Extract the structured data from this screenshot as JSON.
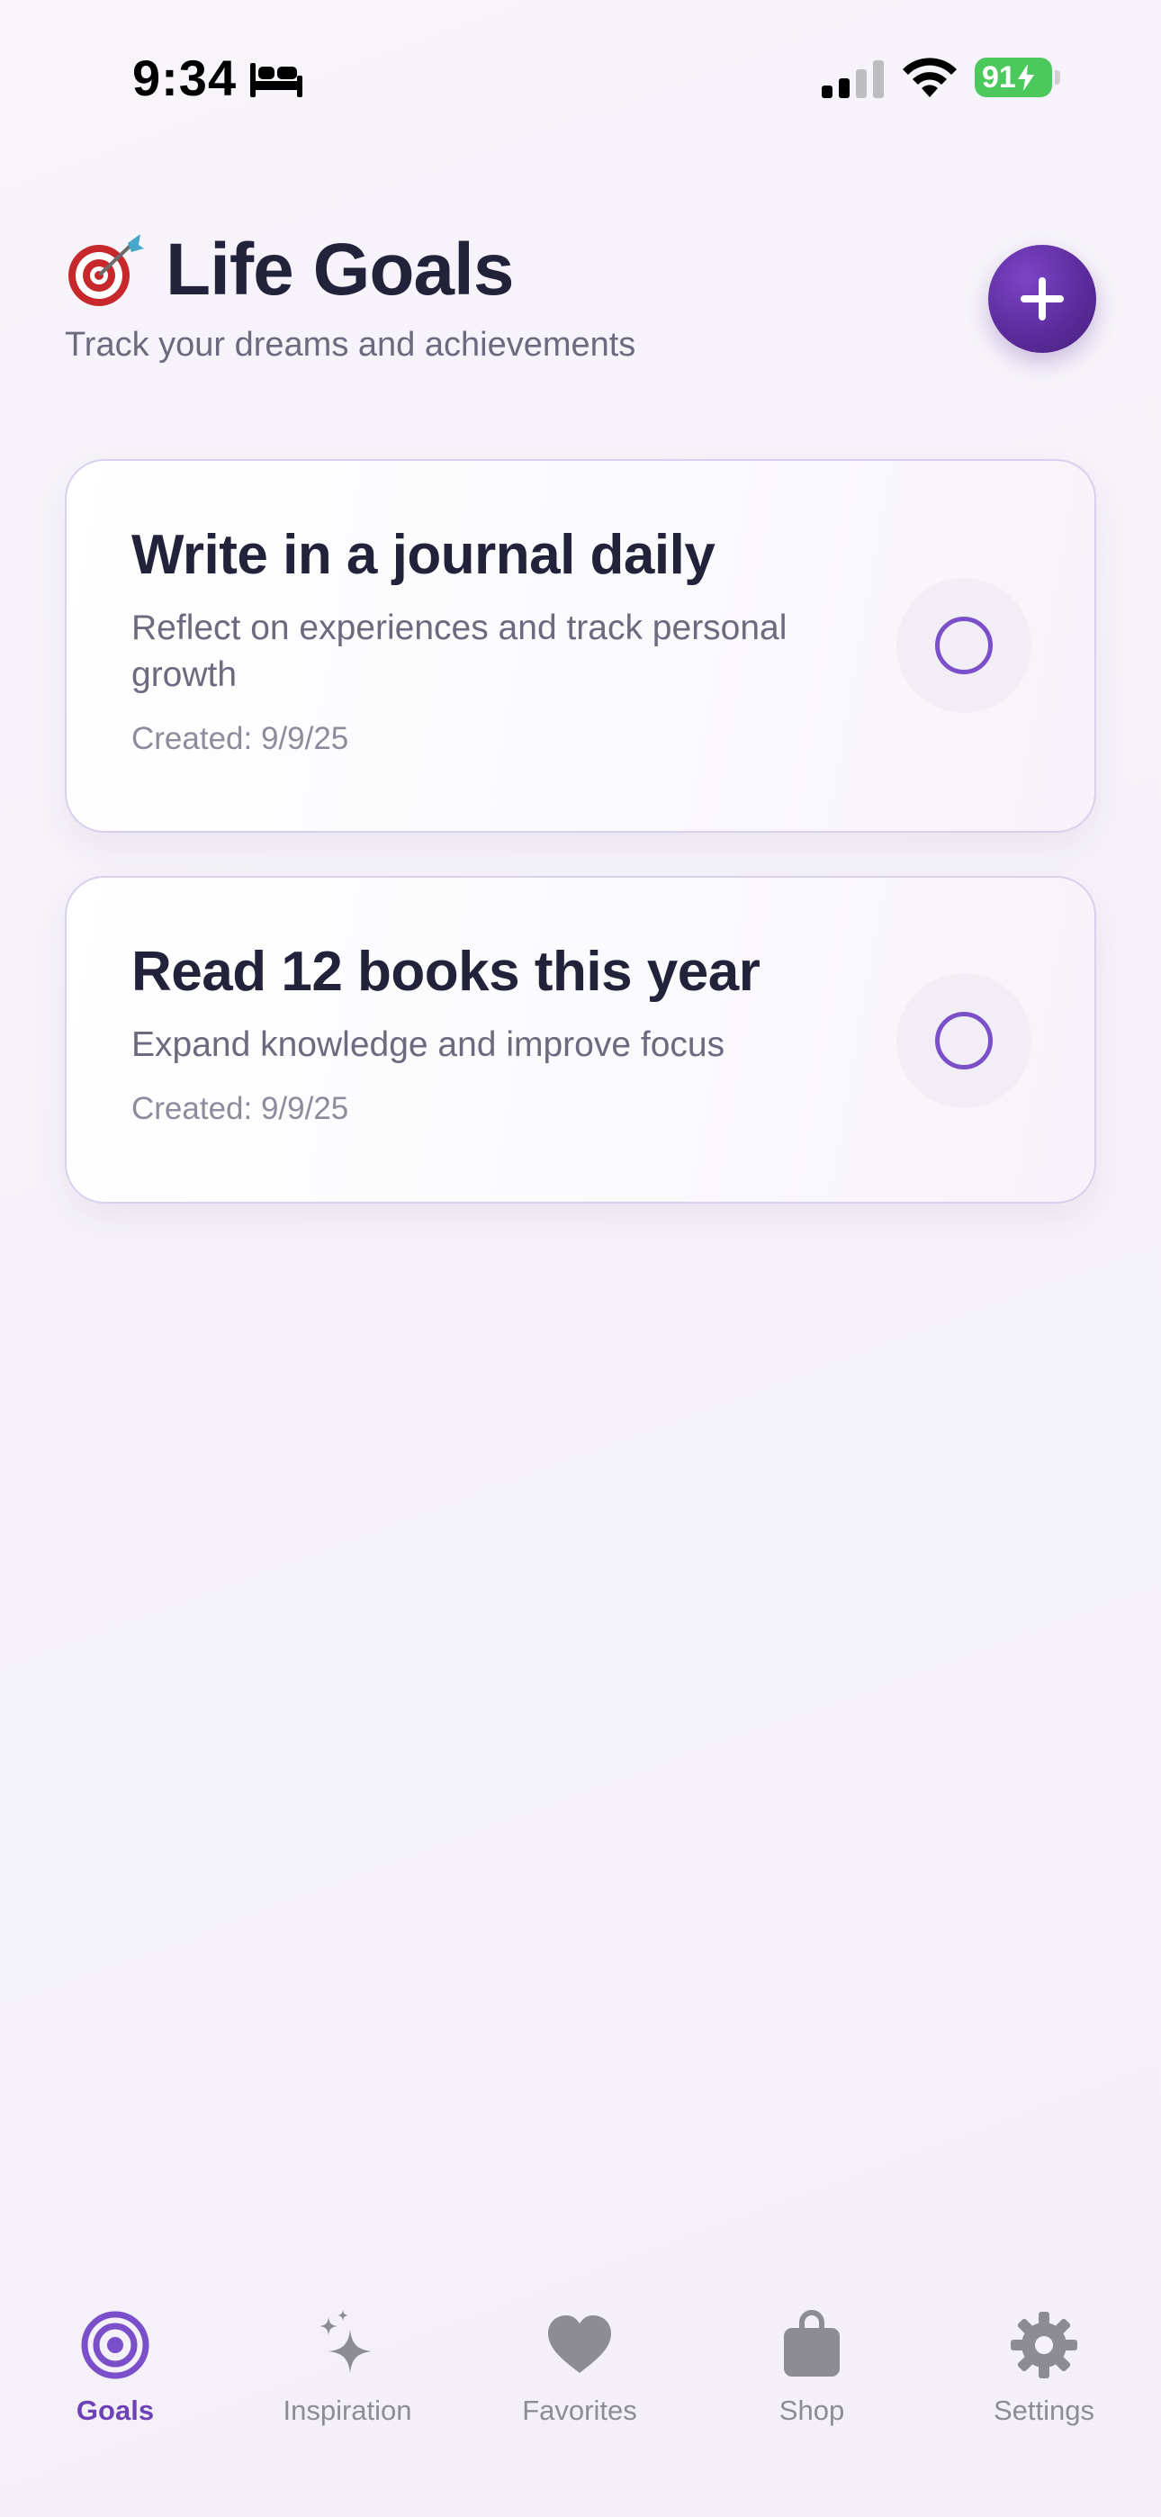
{
  "status_bar": {
    "time": "9:34",
    "battery_level": "91",
    "icons": [
      "bed-icon",
      "signal-icon",
      "wifi-icon",
      "battery-charging-icon"
    ]
  },
  "header": {
    "emoji_icon": "target-dart-icon",
    "title": "Life Goals",
    "subtitle": "Track your dreams and achievements",
    "add_button_icon": "plus-icon"
  },
  "goals": [
    {
      "title": "Write in a journal daily",
      "description": "Reflect on experiences and track personal growth",
      "created": "Created: 9/9/25",
      "completed": false
    },
    {
      "title": "Read 12 books this year",
      "description": "Expand knowledge and improve focus",
      "created": "Created: 9/9/25",
      "completed": false
    }
  ],
  "tab_bar": {
    "items": [
      {
        "label": "Goals",
        "icon": "target-icon",
        "active": true
      },
      {
        "label": "Inspiration",
        "icon": "sparkles-icon",
        "active": false
      },
      {
        "label": "Favorites",
        "icon": "heart-icon",
        "active": false
      },
      {
        "label": "Shop",
        "icon": "shopping-bag-icon",
        "active": false
      },
      {
        "label": "Settings",
        "icon": "gear-icon",
        "active": false
      }
    ]
  },
  "colors": {
    "accent": "#6f41b8",
    "add_button": "#5a2a99",
    "battery": "#4cc95d",
    "title_text": "#23223b",
    "secondary_text": "#6b6a7e",
    "inactive_tab": "#8d8c94"
  }
}
